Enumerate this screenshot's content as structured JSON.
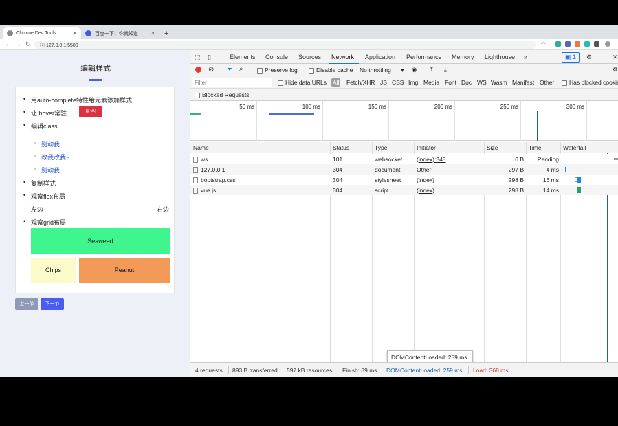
{
  "tabs": [
    {
      "title": "Chrome Dev Tools",
      "active": true
    },
    {
      "title": "百度一下，你就知道",
      "active": false
    }
  ],
  "address": {
    "url": "127.0.0.1:5500"
  },
  "page": {
    "title": "编辑样式",
    "items": [
      "用auto-complete特性给元素添加样式",
      "让:hover常驻",
      "编辑class",
      "复制样式",
      "观察flex布局",
      "观察grid布局"
    ],
    "hover_button": "悬停!",
    "sub_items": [
      "别动我",
      "改我改我~",
      "别动我"
    ],
    "flex_left": "左边",
    "flex_right": "右边",
    "grid": {
      "seaweed": "Seaweed",
      "chips": "Chips",
      "peanut": "Peanut"
    },
    "prev_button": "上一节",
    "next_button": "下一节"
  },
  "devtools": {
    "tabs": [
      "Elements",
      "Console",
      "Sources",
      "Network",
      "Application",
      "Performance",
      "Memory",
      "Lighthouse"
    ],
    "more": "»",
    "issues_count": "1",
    "toolbar": {
      "preserve_log": "Preserve log",
      "disable_cache": "Disable cache",
      "throttling": "No throttling"
    },
    "filter": {
      "placeholder": "Filter",
      "hide_data_urls": "Hide data URLs",
      "types": [
        "All",
        "Fetch/XHR",
        "JS",
        "CSS",
        "Img",
        "Media",
        "Font",
        "Doc",
        "WS",
        "Wasm",
        "Manifest",
        "Other"
      ],
      "has_blocked_cookies": "Has blocked cookies"
    },
    "blocked_requests": "Blocked Requests",
    "timeline_ticks": [
      "50 ms",
      "100 ms",
      "150 ms",
      "200 ms",
      "250 ms",
      "300 ms"
    ],
    "columns": [
      "Name",
      "Status",
      "Type",
      "Initiator",
      "Size",
      "Time",
      "Waterfall"
    ],
    "requests": [
      {
        "name": "ws",
        "status": "101",
        "type": "websocket",
        "initiator": "(index):345",
        "size": "0 B",
        "time": "Pending"
      },
      {
        "name": "127.0.0.1",
        "status": "304",
        "type": "document",
        "initiator": "Other",
        "size": "297 B",
        "time": "4 ms"
      },
      {
        "name": "bootstrap.css",
        "status": "304",
        "type": "stylesheet",
        "initiator": "(index)",
        "size": "298 B",
        "time": "16 ms"
      },
      {
        "name": "vue.js",
        "status": "304",
        "type": "script",
        "initiator": "(index)",
        "size": "298 B",
        "time": "14 ms"
      }
    ],
    "status": {
      "requests": "4 requests",
      "transferred": "893 B transferred",
      "resources": "597 kB resources",
      "finish": "Finish: 89 ms",
      "dcl": "DOMContentLoaded: 259 ms",
      "load": "Load: 368 ms"
    },
    "tooltip": "DOMContentLoaded: 259 ms"
  },
  "colors": {
    "accent": "#4b5cf0",
    "danger": "#d93343",
    "seaweed": "#3ef58e",
    "chips": "#fbfbc9",
    "peanut": "#f49a59",
    "dcl": "#1a5fb4",
    "load": "#c62828"
  }
}
